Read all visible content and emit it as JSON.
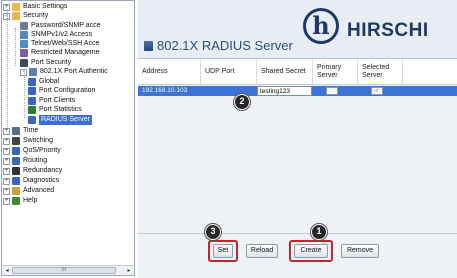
{
  "tree": {
    "items": [
      {
        "label": "Basic Settings",
        "icon": "folder-icon",
        "expander": "+",
        "color": "#e8b84a"
      },
      {
        "label": "Security",
        "icon": "folder-icon",
        "expander": "−",
        "color": "#e8b84a"
      },
      {
        "label": "Password/SNMP acce",
        "icon": "password-icon",
        "color": "#6b7c8f"
      },
      {
        "label": "SNMPv1/v2 Access",
        "icon": "snmp-icon",
        "color": "#5b84c4"
      },
      {
        "label": "Telnet/Web/SSH Acce",
        "icon": "telnet-icon",
        "color": "#4f8fc9"
      },
      {
        "label": "Restricted Manageme",
        "icon": "restricted-icon",
        "color": "#7a5ab3"
      },
      {
        "label": "Port Security",
        "icon": "port-security-icon",
        "color": "#3d4a5a"
      },
      {
        "label": "802.1X Port Authentic",
        "icon": "folder-icon",
        "expander": "−",
        "color": "#5d7fb0"
      },
      {
        "label": "Global",
        "icon": "global-icon",
        "color": "#3a66b8"
      },
      {
        "label": "Port Configuration",
        "icon": "port-config-icon",
        "color": "#3a66b8"
      },
      {
        "label": "Port Clients",
        "icon": "port-clients-icon",
        "color": "#3a66b8"
      },
      {
        "label": "Port Statistics",
        "icon": "port-statistics-icon",
        "color": "#2e7a3a"
      },
      {
        "label": "RADIUS Server",
        "icon": "radius-server-icon",
        "color": "#3a66b8",
        "selected": true
      },
      {
        "label": "Time",
        "icon": "clock-icon",
        "expander": "+",
        "color": "#5a6b7d"
      },
      {
        "label": "Switching",
        "icon": "switching-icon",
        "expander": "+",
        "color": "#444"
      },
      {
        "label": "QoS/Priority",
        "icon": "qos-icon",
        "expander": "+",
        "color": "#3a66b8"
      },
      {
        "label": "Routing",
        "icon": "routing-icon",
        "expander": "+",
        "color": "#3a66b8"
      },
      {
        "label": "Redundancy",
        "icon": "redundancy-icon",
        "expander": "+",
        "color": "#333"
      },
      {
        "label": "Diagnostics",
        "icon": "diagnostics-icon",
        "expander": "+",
        "color": "#3a66b8"
      },
      {
        "label": "Advanced",
        "icon": "advanced-icon",
        "expander": "+",
        "color": "#c9a23a"
      },
      {
        "label": "Help",
        "icon": "help-icon",
        "expander": "+",
        "color": "#3a8a3a"
      }
    ],
    "scroll_left": "◂",
    "scroll_right": "▸",
    "scroll_thumb": "III"
  },
  "header": {
    "title": "802.1X RADIUS Server",
    "logo_glyph": "h",
    "brand": "HIRSCHI",
    "brand_color": "#1d3a66"
  },
  "table": {
    "columns": [
      "Address",
      "UDP Port",
      "Shared Secret",
      "Primary Server",
      "Selected Server"
    ],
    "rows": [
      {
        "address": "192.168.10.103",
        "udp_port": "",
        "shared_secret": "testing123",
        "primary": false,
        "selected": true
      }
    ],
    "selected_row_color": "#3b74d6"
  },
  "toolbar": {
    "set_label": "Set",
    "reload_label": "Reload",
    "create_label": "Create",
    "remove_label": "Remove"
  },
  "callouts": {
    "create": "1",
    "secret": "2",
    "set": "3"
  },
  "highlight_color": "#c0262d"
}
